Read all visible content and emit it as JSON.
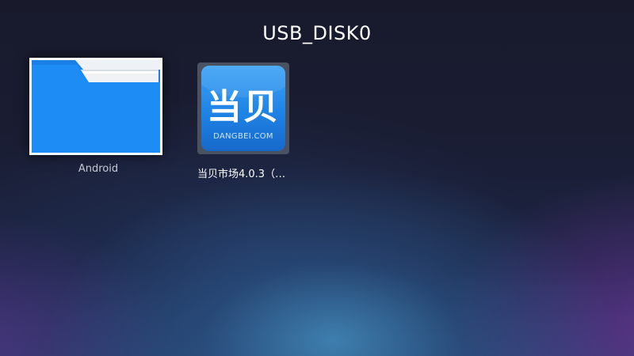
{
  "header": {
    "title": "USB_DISK0"
  },
  "items": [
    {
      "type": "folder",
      "label": "Android",
      "icon": "folder-icon",
      "selected": true
    },
    {
      "type": "app",
      "label": "当贝市场4.0.3（电…",
      "icon": "dangbei-app-icon",
      "logo_text": "当贝",
      "logo_subtext": "DANGBEI.COM"
    }
  ],
  "colors": {
    "folder_blue": "#1e8cf5",
    "app_blue": "#2a8ff0",
    "focus_border": "#ffffff"
  }
}
